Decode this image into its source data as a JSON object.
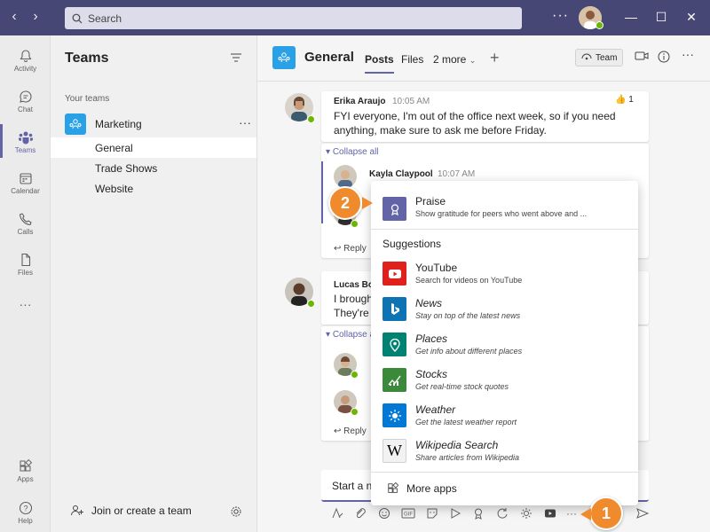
{
  "search": {
    "placeholder": "Search"
  },
  "colors": {
    "brand": "#464775",
    "accent": "#6264a7",
    "callout": "#f08b2d",
    "presence": "#6bb700"
  },
  "rail": [
    {
      "label": "Activity",
      "icon": "bell-icon"
    },
    {
      "label": "Chat",
      "icon": "chat-icon"
    },
    {
      "label": "Teams",
      "icon": "teams-icon"
    },
    {
      "label": "Calendar",
      "icon": "calendar-icon"
    },
    {
      "label": "Calls",
      "icon": "phone-icon"
    },
    {
      "label": "Files",
      "icon": "file-icon"
    },
    {
      "label": "",
      "icon": "more-icon"
    },
    {
      "label": "Apps",
      "icon": "apps-icon"
    },
    {
      "label": "Help",
      "icon": "help-icon"
    }
  ],
  "panel": {
    "title": "Teams",
    "section": "Your teams",
    "team": "Marketing",
    "more": "···",
    "channels": [
      "General",
      "Trade Shows",
      "Website"
    ],
    "join": "Join or create a team"
  },
  "header": {
    "channel": "General",
    "tabs": [
      "Posts",
      "Files",
      "2 more"
    ],
    "team_button": "Team"
  },
  "messages": [
    {
      "author": "Erika Araujo",
      "time": "10:05 AM",
      "body_line1": "FYI everyone, I'm out of the office next week, so if you need",
      "body_line2": "anything, make sure to ask me before Friday.",
      "reaction_count": "1",
      "collapse": "Collapse all",
      "reply_author": "Kayla Claypool",
      "reply_time": "10:07 AM",
      "reply": "Reply"
    },
    {
      "author": "Lucas Bo",
      "body_line1": "I brough",
      "body_line2": "They're i",
      "collapse": "Collapse a",
      "reply": "Reply"
    }
  ],
  "compose": {
    "placeholder": "Start a n"
  },
  "popup": {
    "top": {
      "name": "Praise",
      "desc": "Show gratitude for peers who went above and ..."
    },
    "suggestions_label": "Suggestions",
    "apps": [
      {
        "name": "YouTube",
        "desc": "Search for videos on YouTube",
        "color": "#e0201b",
        "icon": "youtube-icon"
      },
      {
        "name": "News",
        "desc": "Stay on top of the latest news",
        "color": "#0e73b2",
        "icon": "bing-icon"
      },
      {
        "name": "Places",
        "desc": "Get info about different places",
        "color": "#008272",
        "icon": "map-pin-icon"
      },
      {
        "name": "Stocks",
        "desc": "Get real-time stock quotes",
        "color": "#3b8a3b",
        "icon": "stocks-icon"
      },
      {
        "name": "Weather",
        "desc": "Get the latest weather report",
        "color": "#0078d4",
        "icon": "sun-icon"
      },
      {
        "name": "Wikipedia Search",
        "desc": "Share articles from Wikipedia",
        "color": "#f2f2f2",
        "icon": "wikipedia-icon"
      }
    ],
    "more_apps": "More apps"
  },
  "steps": [
    "1",
    "2"
  ]
}
